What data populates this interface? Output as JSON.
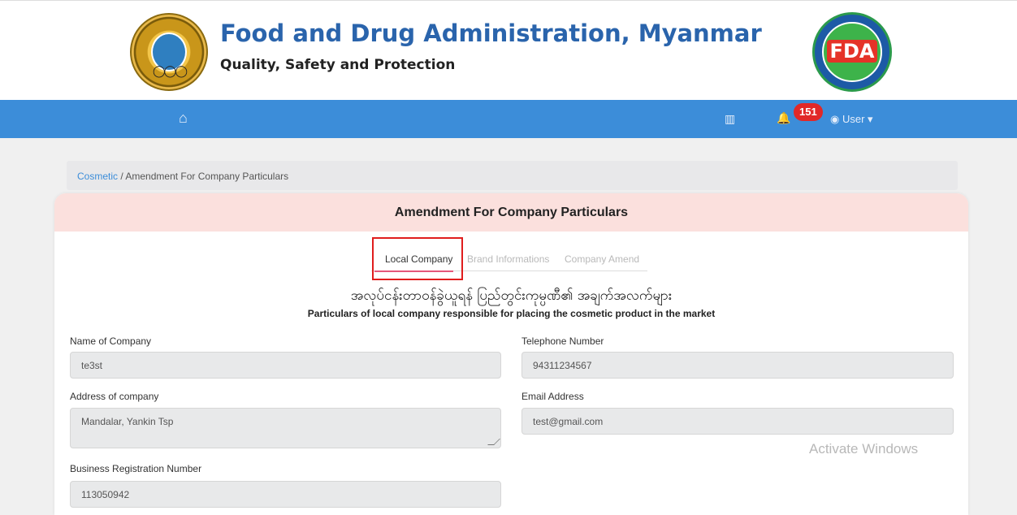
{
  "header": {
    "title": "Food and Drug Administration, Myanmar",
    "subtitle": "Quality, Safety and Protection",
    "right_logo_text": "FDA"
  },
  "navbar": {
    "home_icon": "home-icon",
    "notification_count": "151",
    "user_label": "User"
  },
  "breadcrumb": {
    "root": "Cosmetic",
    "separator": "/",
    "current": "Amendment For Company Particulars"
  },
  "card": {
    "title": "Amendment For Company Particulars",
    "tabs": [
      {
        "label": "Local Company"
      },
      {
        "label": "Brand Informations"
      },
      {
        "label": "Company Amend"
      }
    ],
    "myanmar_heading": "အလုပ်ငန်းတာဝန်ခွဲယူရန် ပြည်တွင်းကုမ္ပဏီ၏ အချက်အလက်များ",
    "english_heading": "Particulars of local company responsible for placing the cosmetic product in the market"
  },
  "form": {
    "company_name": {
      "label": "Name of Company",
      "value": "te3st"
    },
    "telephone": {
      "label": "Telephone Number",
      "value": "94311234567"
    },
    "address": {
      "label": "Address of company",
      "value": "Mandalar, Yankin Tsp"
    },
    "email": {
      "label": "Email Address",
      "value": "test@gmail.com"
    },
    "business_registration": {
      "label": "Business Registration Number",
      "value": "113050942"
    }
  },
  "watermark": "Activate Windows",
  "colors": {
    "navbar": "#3c8dd9",
    "card_header": "#fbe0dd",
    "active_tab_underline": "#e5577a",
    "badge": "#e12828"
  }
}
